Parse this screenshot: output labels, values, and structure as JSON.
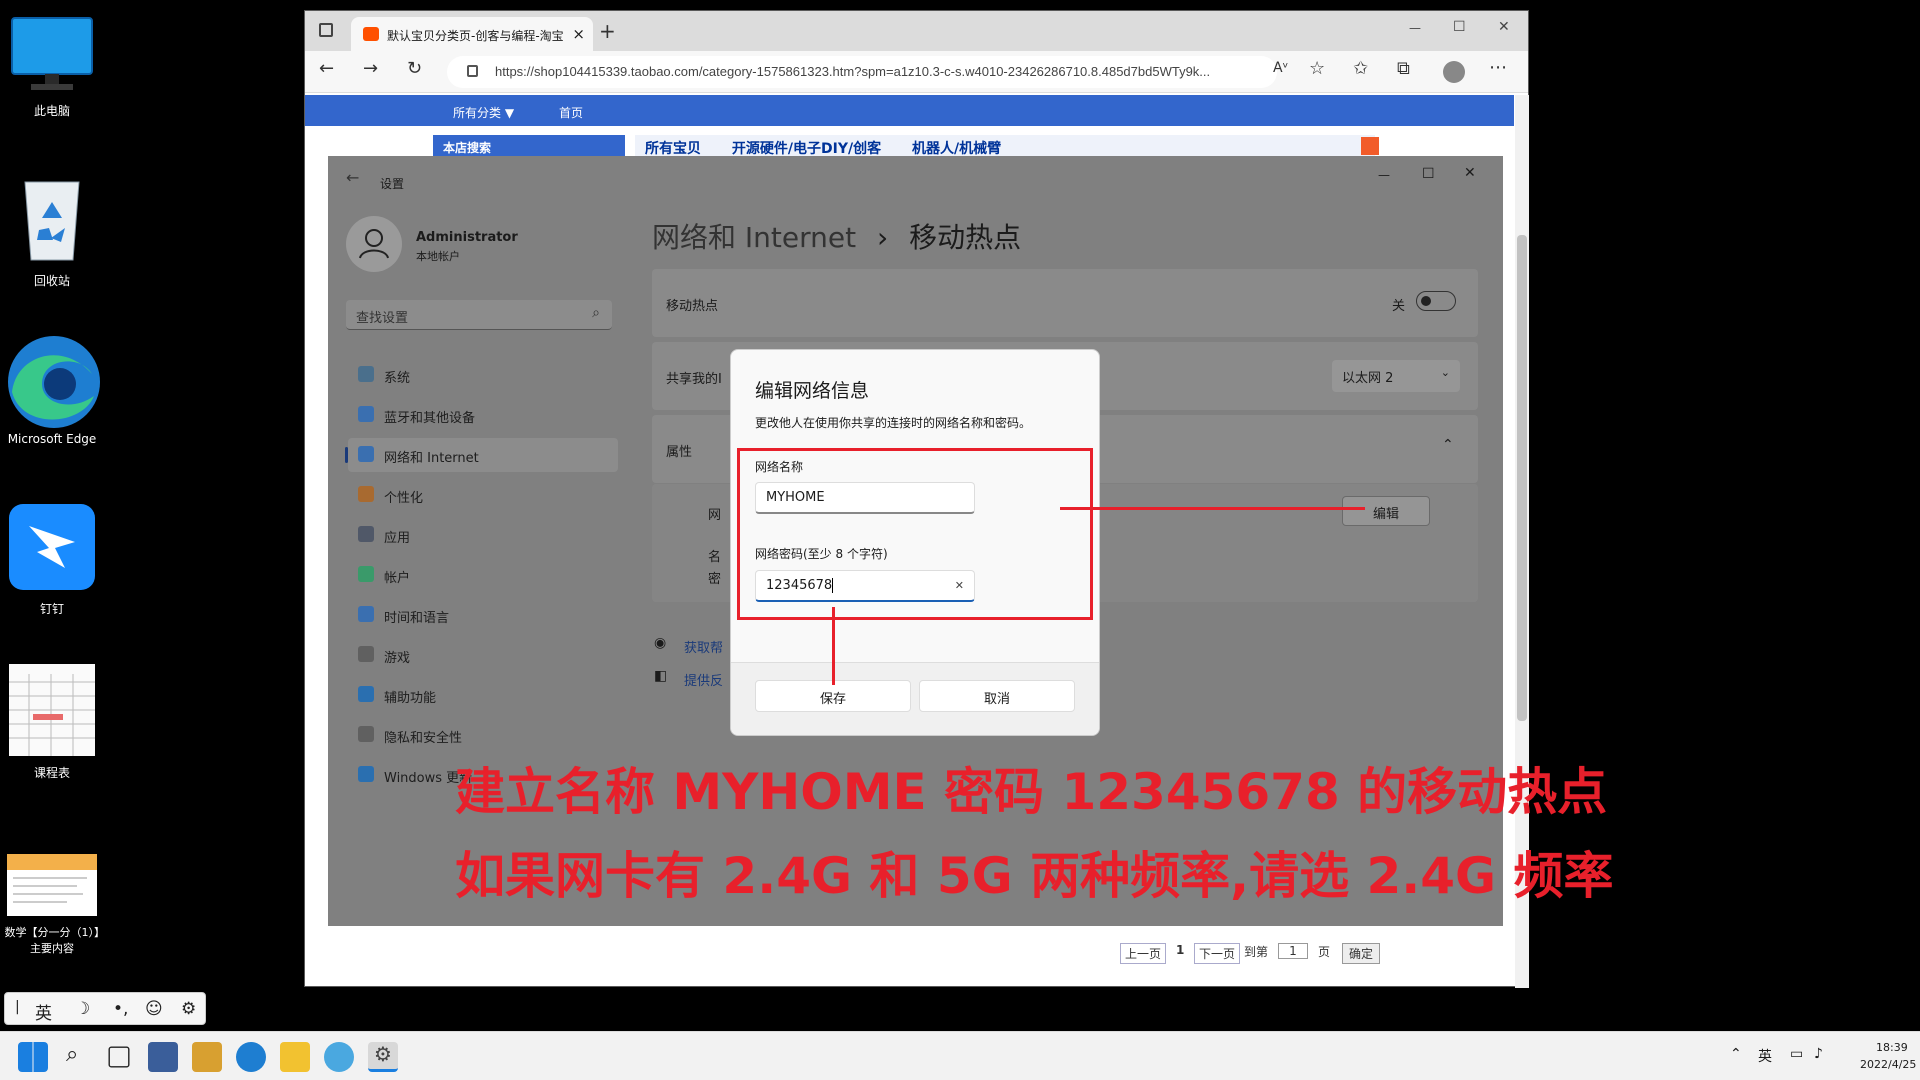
{
  "desktop": {
    "icons": [
      {
        "label": "此电脑"
      },
      {
        "label": "回收站"
      },
      {
        "label": "Microsoft Edge"
      },
      {
        "label": "钉钉"
      },
      {
        "label": "课程表"
      },
      {
        "label": "数学【分一分（1）】主要内容"
      }
    ]
  },
  "browser": {
    "tab_title": "默认宝贝分类页-创客与编程-淘宝",
    "tab_close": "×",
    "new_tab": "+",
    "url": "https://shop104415339.taobao.com/category-1575861323.htm?spm=a1z10.3-c-s.w4010-23426286710.8.485d7bd5WTy9k...",
    "win_controls": {
      "min": "—",
      "max": "☐",
      "close": "✕"
    },
    "page_nav": {
      "all_categories": "所有分类 ▼",
      "home": "首页",
      "store_search": "本店搜索"
    },
    "breadcrumb": [
      "所有宝贝",
      "开源硬件/电子DIY/创客",
      "机器人/机械臂"
    ]
  },
  "settings": {
    "back": "←",
    "app_title": "设置",
    "user_name": "Administrator",
    "user_type": "本地帐户",
    "search_placeholder": "查找设置",
    "nav": [
      {
        "label": "系统",
        "color": "#4a6f8c"
      },
      {
        "label": "蓝牙和其他设备",
        "color": "#3a6fb0"
      },
      {
        "label": "网络和 Internet",
        "color": "#3a6fb0"
      },
      {
        "label": "个性化",
        "color": "#a86a30"
      },
      {
        "label": "应用",
        "color": "#505868"
      },
      {
        "label": "帐户",
        "color": "#3a9a6a"
      },
      {
        "label": "时间和语言",
        "color": "#3a6fb0"
      },
      {
        "label": "游戏",
        "color": "#606060"
      },
      {
        "label": "辅助功能",
        "color": "#2a6fb0"
      },
      {
        "label": "隐私和安全性",
        "color": "#606060"
      },
      {
        "label": "Windows 更新",
        "color": "#2a6fb0"
      }
    ],
    "page_title_parent": "网络和 Internet",
    "page_title_sep": "›",
    "page_title": "移动热点",
    "hotspot_label": "移动热点",
    "hotspot_state": "关",
    "share_label": "共享我的I",
    "share_value": "以太网 2",
    "properties_label": "属性",
    "prop_row1": "网",
    "prop_row2": "名",
    "prop_row3": "密",
    "edit_button": "编辑",
    "help_link": "获取帮",
    "feedback_link": "提供反"
  },
  "dialog": {
    "title": "编辑网络信息",
    "description": "更改他人在使用你共享的连接时的网络名称和密码。",
    "name_label": "网络名称",
    "name_value": "MYHOME",
    "password_label": "网络密码(至少 8 个字符)",
    "password_value": "12345678",
    "clear_icon": "✕",
    "save": "保存",
    "cancel": "取消"
  },
  "caption": {
    "line1": "建立名称 MYHOME 密码 12345678 的移动热点",
    "line2": "如果网卡有 2.4G 和 5G 两种频率,请选 2.4G 频率"
  },
  "pagination": {
    "prev": "上一页",
    "current": "1",
    "next": "下一页",
    "goto": "到第",
    "page_input": "1",
    "page_unit": "页",
    "confirm": "确定"
  },
  "ime": {
    "mode": "英"
  },
  "taskbar": {
    "lang": "英",
    "time": "18:39",
    "date": "2022/4/25"
  },
  "colors": {
    "accent": "#3366cc",
    "annotation": "#e8202b"
  }
}
